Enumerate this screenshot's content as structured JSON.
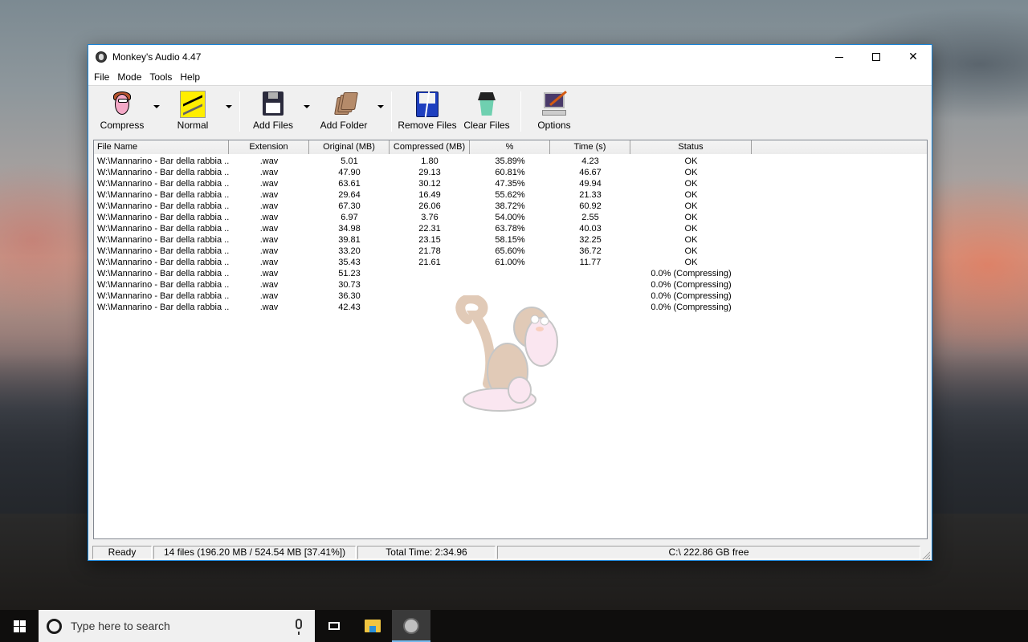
{
  "window": {
    "title": "Monkey's Audio 4.47",
    "controls": {
      "minimize": "minimize",
      "maximize": "maximize",
      "close": "✕"
    }
  },
  "menu": [
    "File",
    "Mode",
    "Tools",
    "Help"
  ],
  "toolbar": {
    "compress": "Compress",
    "normal": "Normal",
    "add_files": "Add Files",
    "add_folder": "Add Folder",
    "remove_files": "Remove Files",
    "clear_files": "Clear Files",
    "options": "Options"
  },
  "list": {
    "columns": [
      "File Name",
      "Extension",
      "Original (MB)",
      "Compressed (MB)",
      "%",
      "Time (s)",
      "Status"
    ],
    "rows": [
      {
        "name": "W:\\Mannarino - Bar della rabbia ...",
        "ext": ".wav",
        "orig": "5.01",
        "comp": "1.80",
        "pct": "35.89%",
        "time": "4.23",
        "status": "OK"
      },
      {
        "name": "W:\\Mannarino - Bar della rabbia ...",
        "ext": ".wav",
        "orig": "47.90",
        "comp": "29.13",
        "pct": "60.81%",
        "time": "46.67",
        "status": "OK"
      },
      {
        "name": "W:\\Mannarino - Bar della rabbia ...",
        "ext": ".wav",
        "orig": "63.61",
        "comp": "30.12",
        "pct": "47.35%",
        "time": "49.94",
        "status": "OK"
      },
      {
        "name": "W:\\Mannarino - Bar della rabbia ...",
        "ext": ".wav",
        "orig": "29.64",
        "comp": "16.49",
        "pct": "55.62%",
        "time": "21.33",
        "status": "OK"
      },
      {
        "name": "W:\\Mannarino - Bar della rabbia ...",
        "ext": ".wav",
        "orig": "67.30",
        "comp": "26.06",
        "pct": "38.72%",
        "time": "60.92",
        "status": "OK"
      },
      {
        "name": "W:\\Mannarino - Bar della rabbia ...",
        "ext": ".wav",
        "orig": "6.97",
        "comp": "3.76",
        "pct": "54.00%",
        "time": "2.55",
        "status": "OK"
      },
      {
        "name": "W:\\Mannarino - Bar della rabbia ...",
        "ext": ".wav",
        "orig": "34.98",
        "comp": "22.31",
        "pct": "63.78%",
        "time": "40.03",
        "status": "OK"
      },
      {
        "name": "W:\\Mannarino - Bar della rabbia ...",
        "ext": ".wav",
        "orig": "39.81",
        "comp": "23.15",
        "pct": "58.15%",
        "time": "32.25",
        "status": "OK"
      },
      {
        "name": "W:\\Mannarino - Bar della rabbia ...",
        "ext": ".wav",
        "orig": "33.20",
        "comp": "21.78",
        "pct": "65.60%",
        "time": "36.72",
        "status": "OK"
      },
      {
        "name": "W:\\Mannarino - Bar della rabbia ...",
        "ext": ".wav",
        "orig": "35.43",
        "comp": "21.61",
        "pct": "61.00%",
        "time": "11.77",
        "status": "OK"
      },
      {
        "name": "W:\\Mannarino - Bar della rabbia ...",
        "ext": ".wav",
        "orig": "51.23",
        "comp": "",
        "pct": "",
        "time": "",
        "status": "0.0% (Compressing)"
      },
      {
        "name": "W:\\Mannarino - Bar della rabbia ...",
        "ext": ".wav",
        "orig": "30.73",
        "comp": "",
        "pct": "",
        "time": "",
        "status": "0.0% (Compressing)"
      },
      {
        "name": "W:\\Mannarino - Bar della rabbia ...",
        "ext": ".wav",
        "orig": "36.30",
        "comp": "",
        "pct": "",
        "time": "",
        "status": "0.0% (Compressing)"
      },
      {
        "name": "W:\\Mannarino - Bar della rabbia ...",
        "ext": ".wav",
        "orig": "42.43",
        "comp": "",
        "pct": "",
        "time": "",
        "status": "0.0% (Compressing)"
      }
    ]
  },
  "statusbar": {
    "state": "Ready",
    "files": "14 files (196.20 MB / 524.54 MB [37.41%])",
    "total_time": "Total Time: 2:34.96",
    "free_space": "C:\\ 222.86 GB free"
  },
  "taskbar": {
    "search_placeholder": "Type here to search"
  }
}
